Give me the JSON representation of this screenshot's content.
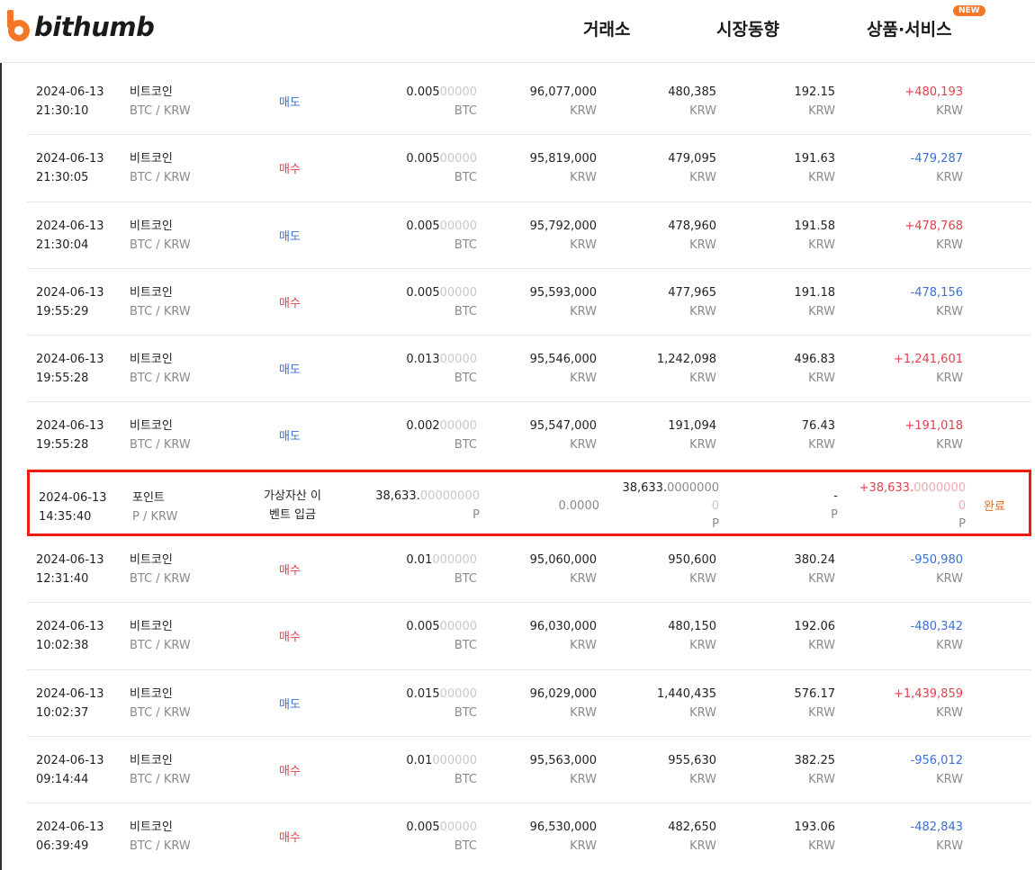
{
  "brand": {
    "name": "bithumb",
    "accent": "#f47725"
  },
  "nav": {
    "exchange": "거래소",
    "market": "시장동향",
    "services": "상품·서비스",
    "new_badge": "NEW"
  },
  "colors": {
    "buy": "#e2414c",
    "sell": "#3b6fd6",
    "status": "#e06d1f",
    "highlight_border": "#ee1c0e"
  },
  "rows": [
    {
      "date": "2024-06-13",
      "time": "21:30:10",
      "coin": "비트코인",
      "pair": "BTC / KRW",
      "type": "매도",
      "side": "sell",
      "qty_main": "0.005",
      "qty_tail": "00000",
      "qty_unit": "BTC",
      "price": "96,077,000",
      "price_unit": "KRW",
      "amount": "480,385",
      "amount_unit": "KRW",
      "fee": "192.15",
      "fee_unit": "KRW",
      "settle": "+480,193",
      "settle_unit": "KRW"
    },
    {
      "date": "2024-06-13",
      "time": "21:30:05",
      "coin": "비트코인",
      "pair": "BTC / KRW",
      "type": "매수",
      "side": "buy",
      "qty_main": "0.005",
      "qty_tail": "00000",
      "qty_unit": "BTC",
      "price": "95,819,000",
      "price_unit": "KRW",
      "amount": "479,095",
      "amount_unit": "KRW",
      "fee": "191.63",
      "fee_unit": "KRW",
      "settle": "-479,287",
      "settle_unit": "KRW"
    },
    {
      "date": "2024-06-13",
      "time": "21:30:04",
      "coin": "비트코인",
      "pair": "BTC / KRW",
      "type": "매도",
      "side": "sell",
      "qty_main": "0.005",
      "qty_tail": "00000",
      "qty_unit": "BTC",
      "price": "95,792,000",
      "price_unit": "KRW",
      "amount": "478,960",
      "amount_unit": "KRW",
      "fee": "191.58",
      "fee_unit": "KRW",
      "settle": "+478,768",
      "settle_unit": "KRW"
    },
    {
      "date": "2024-06-13",
      "time": "19:55:29",
      "coin": "비트코인",
      "pair": "BTC / KRW",
      "type": "매수",
      "side": "buy",
      "qty_main": "0.005",
      "qty_tail": "00000",
      "qty_unit": "BTC",
      "price": "95,593,000",
      "price_unit": "KRW",
      "amount": "477,965",
      "amount_unit": "KRW",
      "fee": "191.18",
      "fee_unit": "KRW",
      "settle": "-478,156",
      "settle_unit": "KRW"
    },
    {
      "date": "2024-06-13",
      "time": "19:55:28",
      "coin": "비트코인",
      "pair": "BTC / KRW",
      "type": "매도",
      "side": "sell",
      "qty_main": "0.013",
      "qty_tail": "00000",
      "qty_unit": "BTC",
      "price": "95,546,000",
      "price_unit": "KRW",
      "amount": "1,242,098",
      "amount_unit": "KRW",
      "fee": "496.83",
      "fee_unit": "KRW",
      "settle": "+1,241,601",
      "settle_unit": "KRW"
    },
    {
      "date": "2024-06-13",
      "time": "19:55:28",
      "coin": "비트코인",
      "pair": "BTC / KRW",
      "type": "매도",
      "side": "sell",
      "qty_main": "0.002",
      "qty_tail": "00000",
      "qty_unit": "BTC",
      "price": "95,547,000",
      "price_unit": "KRW",
      "amount": "191,094",
      "amount_unit": "KRW",
      "fee": "76.43",
      "fee_unit": "KRW",
      "settle": "+191,018",
      "settle_unit": "KRW"
    }
  ],
  "event_row": {
    "date": "2024-06-13",
    "time": "14:35:40",
    "coin": "포인트",
    "pair": "P / KRW",
    "type_line1": "가상자산 이",
    "type_line2": "벤트 입금",
    "qty_main": "38,633.",
    "qty_tail": "00000000",
    "qty_unit": "P",
    "price": "0.0000",
    "amount_main": "38,633.",
    "amount_tail": "0000000",
    "amount_wrap": "0",
    "amount_unit": "P",
    "fee": "-",
    "fee_unit": "P",
    "settle_main": "+38,633.",
    "settle_tail": "0000000",
    "settle_wrap": "0",
    "settle_unit": "P",
    "status": "완료"
  },
  "rows_after": [
    {
      "date": "2024-06-13",
      "time": "12:31:40",
      "coin": "비트코인",
      "pair": "BTC / KRW",
      "type": "매수",
      "side": "buy",
      "qty_main": "0.01",
      "qty_tail": "000000",
      "qty_unit": "BTC",
      "price": "95,060,000",
      "price_unit": "KRW",
      "amount": "950,600",
      "amount_unit": "KRW",
      "fee": "380.24",
      "fee_unit": "KRW",
      "settle": "-950,980",
      "settle_unit": "KRW"
    },
    {
      "date": "2024-06-13",
      "time": "10:02:38",
      "coin": "비트코인",
      "pair": "BTC / KRW",
      "type": "매수",
      "side": "buy",
      "qty_main": "0.005",
      "qty_tail": "00000",
      "qty_unit": "BTC",
      "price": "96,030,000",
      "price_unit": "KRW",
      "amount": "480,150",
      "amount_unit": "KRW",
      "fee": "192.06",
      "fee_unit": "KRW",
      "settle": "-480,342",
      "settle_unit": "KRW"
    },
    {
      "date": "2024-06-13",
      "time": "10:02:37",
      "coin": "비트코인",
      "pair": "BTC / KRW",
      "type": "매도",
      "side": "sell",
      "qty_main": "0.015",
      "qty_tail": "00000",
      "qty_unit": "BTC",
      "price": "96,029,000",
      "price_unit": "KRW",
      "amount": "1,440,435",
      "amount_unit": "KRW",
      "fee": "576.17",
      "fee_unit": "KRW",
      "settle": "+1,439,859",
      "settle_unit": "KRW"
    },
    {
      "date": "2024-06-13",
      "time": "09:14:44",
      "coin": "비트코인",
      "pair": "BTC / KRW",
      "type": "매수",
      "side": "buy",
      "qty_main": "0.01",
      "qty_tail": "000000",
      "qty_unit": "BTC",
      "price": "95,563,000",
      "price_unit": "KRW",
      "amount": "955,630",
      "amount_unit": "KRW",
      "fee": "382.25",
      "fee_unit": "KRW",
      "settle": "-956,012",
      "settle_unit": "KRW"
    },
    {
      "date": "2024-06-13",
      "time": "06:39:49",
      "coin": "비트코인",
      "pair": "BTC / KRW",
      "type": "매수",
      "side": "buy",
      "qty_main": "0.005",
      "qty_tail": "00000",
      "qty_unit": "BTC",
      "price": "96,530,000",
      "price_unit": "KRW",
      "amount": "482,650",
      "amount_unit": "KRW",
      "fee": "193.06",
      "fee_unit": "KRW",
      "settle": "-482,843",
      "settle_unit": "KRW"
    }
  ]
}
